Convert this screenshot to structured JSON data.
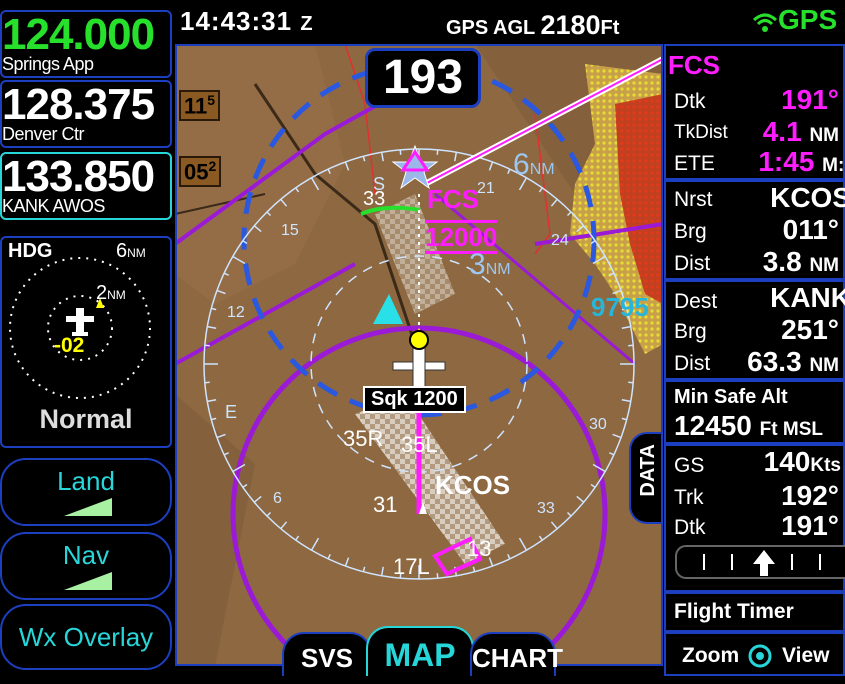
{
  "top_bar": {
    "time": "14:43:31",
    "time_zone": "Z",
    "agl_label": "GPS AGL",
    "agl_value": "2180",
    "agl_unit": "Ft",
    "gps_label": "GPS"
  },
  "comm": [
    {
      "freq": "124.000",
      "label": "Springs App",
      "color": "#27e02b"
    },
    {
      "freq": "128.375",
      "label": "Denver Ctr",
      "color": "#ffffff"
    },
    {
      "freq": "133.850",
      "label": "KANK AWOS",
      "color": "#ffffff"
    }
  ],
  "inset": {
    "hdg_label": "HDG",
    "outer_range": "6",
    "inner_range": "2",
    "range_unit": "NM",
    "vsi": "-02",
    "mode": "Normal"
  },
  "left_buttons": [
    {
      "label": "Land"
    },
    {
      "label": "Nav"
    },
    {
      "label": "Wx Overlay"
    }
  ],
  "map": {
    "track_box": "193",
    "alt_tags": [
      {
        "hundreds": "11",
        "sup": "5"
      },
      {
        "hundreds": "05",
        "sup": "2"
      }
    ],
    "waypoint": "FCS",
    "waypoint_alt": "12000",
    "range_outer": "6",
    "range_inner": "3",
    "range_unit": "NM",
    "terrain_alt": "9795",
    "squawk": "Sqk 1200",
    "airport": "KCOS",
    "runways": [
      "35R",
      "35L",
      "31",
      "17L",
      "13"
    ],
    "compass": [
      "S",
      "33",
      "24",
      "21",
      "15",
      "12",
      "E",
      "6",
      "30",
      "33"
    ],
    "data_tab": "DATA"
  },
  "right_panel": {
    "fcs": {
      "title": "FCS",
      "dtk_label": "Dtk",
      "dtk_value": "191°",
      "tkdist_label": "TkDist",
      "tkdist_value": "4.1",
      "tkdist_unit": "NM",
      "ete_label": "ETE",
      "ete_value": "1:45",
      "ete_unit": "M:S"
    },
    "nrst": {
      "label": "Nrst",
      "value": "KCOS",
      "brg_label": "Brg",
      "brg_value": "011°",
      "dist_label": "Dist",
      "dist_value": "3.8",
      "dist_unit": "NM"
    },
    "dest": {
      "label": "Dest",
      "value": "KANK",
      "brg_label": "Brg",
      "brg_value": "251°",
      "dist_label": "Dist",
      "dist_value": "63.3",
      "dist_unit": "NM"
    },
    "msa": {
      "label": "Min Safe Alt",
      "value": "12450",
      "unit": "Ft MSL"
    },
    "gs": {
      "label": "GS",
      "value": "140",
      "unit": "Kts"
    },
    "trk": {
      "label": "Trk",
      "value": "192°"
    },
    "dtk2": {
      "label": "Dtk",
      "value": "191°"
    },
    "timer": {
      "label": "Flight Timer"
    },
    "zoom": {
      "zoom_label": "Zoom",
      "view_label": "View"
    }
  },
  "tabs": [
    "SVS",
    "MAP",
    "CHART"
  ],
  "colors": {
    "magenta": "#ff1dff",
    "cyan": "#27d6d9",
    "green": "#27e02b",
    "blue": "#1c3fbf"
  }
}
